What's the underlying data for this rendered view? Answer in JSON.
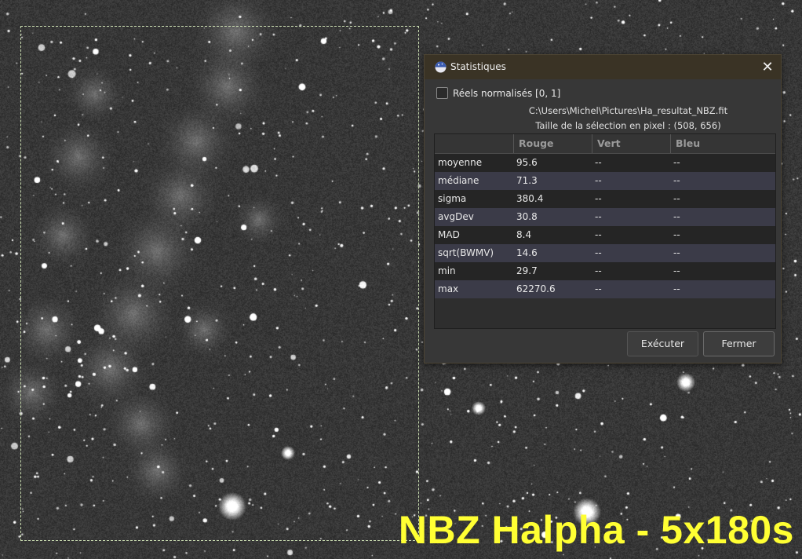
{
  "caption": "NBZ Halpha - 5x180s",
  "dialog": {
    "title": "Statistiques",
    "normalized_label": "Réels normalisés [0, 1]",
    "normalized_checked": false,
    "file_path": "C:\\Users\\Michel\\Pictures\\Ha_resultat_NBZ.fit",
    "selection_size": "Taille de la sélection en pixel : (508, 656)",
    "columns": [
      "",
      "Rouge",
      "Vert",
      "Bleu"
    ],
    "rows": [
      {
        "name": "moyenne",
        "red": "95.6",
        "green": "--",
        "blue": "--"
      },
      {
        "name": "médiane",
        "red": "71.3",
        "green": "--",
        "blue": "--"
      },
      {
        "name": "sigma",
        "red": "380.4",
        "green": "--",
        "blue": "--"
      },
      {
        "name": "avgDev",
        "red": "30.8",
        "green": "--",
        "blue": "--"
      },
      {
        "name": "MAD",
        "red": "8.4",
        "green": "--",
        "blue": "--"
      },
      {
        "name": "sqrt(BWMV)",
        "red": "14.6",
        "green": "--",
        "blue": "--"
      },
      {
        "name": "min",
        "red": "29.7",
        "green": "--",
        "blue": "--"
      },
      {
        "name": "max",
        "red": "62270.6",
        "green": "--",
        "blue": "--"
      }
    ],
    "execute_label": "Exécuter",
    "close_label": "Fermer",
    "close_icon": "close-x-icon"
  },
  "colors": {
    "caption": "#ffff33",
    "titlebar": "#3a3325",
    "selection": "#c9dcb0"
  }
}
